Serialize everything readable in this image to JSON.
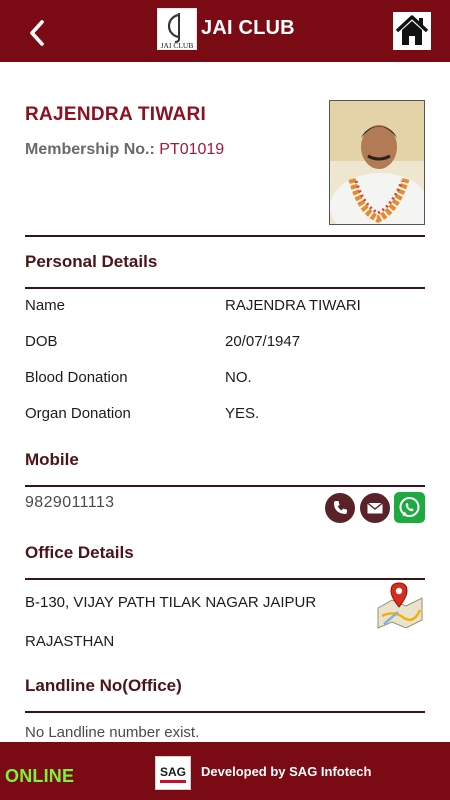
{
  "header": {
    "title": "JAI CLUB",
    "logo_caption": "JAI CLUB",
    "back_icon": "chevron-left-icon",
    "home_icon": "home-icon"
  },
  "profile": {
    "name": "RAJENDRA TIWARI",
    "membership_label": "Membership No.:",
    "membership_number": "PT01019"
  },
  "personal_details": {
    "title": "Personal Details",
    "rows": [
      {
        "label": "Name",
        "value": "RAJENDRA TIWARI"
      },
      {
        "label": "DOB",
        "value": "20/07/1947"
      },
      {
        "label": "Blood Donation",
        "value": "NO."
      },
      {
        "label": "Organ Donation",
        "value": "YES."
      }
    ]
  },
  "mobile": {
    "title": "Mobile",
    "number": "9829011113",
    "actions": [
      "phone-icon",
      "email-icon",
      "whatsapp-icon"
    ]
  },
  "office": {
    "title": "Office Details",
    "address_line1": "B-130, VIJAY PATH TILAK NAGAR JAIPUR",
    "address_line2": "RAJASTHAN",
    "map_icon": "map-location-icon"
  },
  "landline": {
    "title": "Landline No(Office)",
    "message": "No Landline number exist."
  },
  "footer": {
    "status": "ONLINE",
    "sag_logo_text": "SAG",
    "developer_text": "Developed by SAG Infotech"
  },
  "colors": {
    "brand": "#7a0a14",
    "heading": "#4a1419",
    "name": "#8b1120",
    "online": "#7cf33a",
    "whatsapp": "#1ea941"
  }
}
